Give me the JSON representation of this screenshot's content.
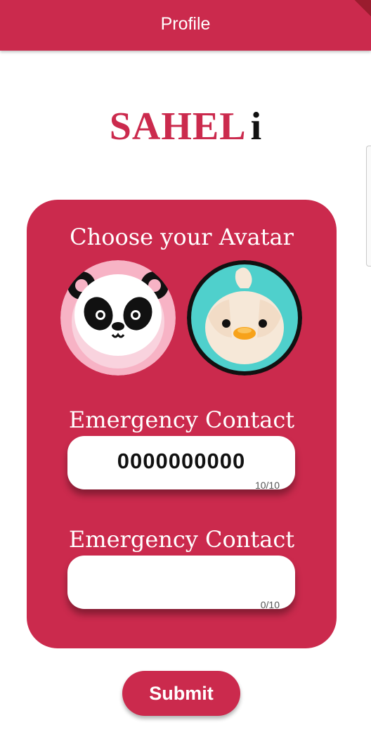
{
  "appbar": {
    "title": "Profile"
  },
  "logo": {
    "main": "SAHEL",
    "tail": "i"
  },
  "card": {
    "avatar_heading": "Choose your Avatar",
    "avatars": [
      {
        "icon": "panda-avatar-icon",
        "selected": false
      },
      {
        "icon": "duck-avatar-icon",
        "selected": true
      }
    ],
    "contact1": {
      "label": "Emergency Contact",
      "value": "0000000000",
      "counter": "10/10"
    },
    "contact2": {
      "label": "Emergency Contact",
      "value": "",
      "counter": "0/10"
    }
  },
  "submit_label": "Submit",
  "colors": {
    "primary": "#cb2a4d",
    "white": "#ffffff"
  }
}
